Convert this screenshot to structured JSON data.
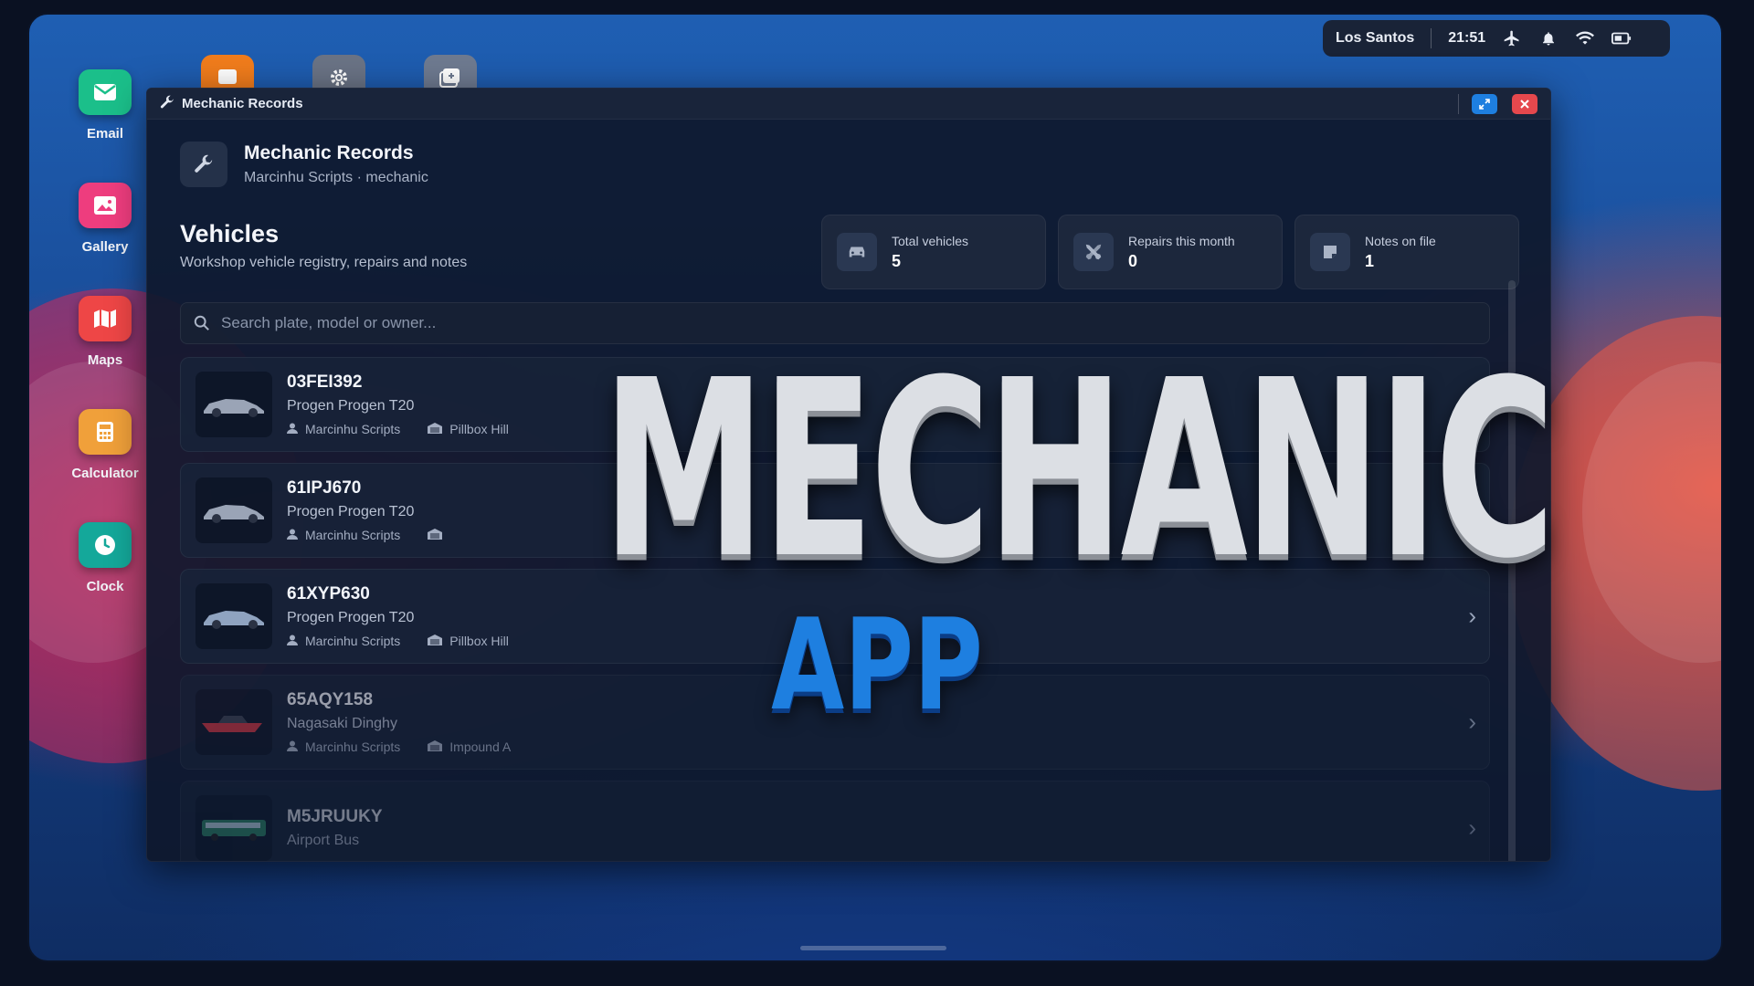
{
  "statusbar": {
    "location": "Los Santos",
    "time": "21:51"
  },
  "dock": [
    {
      "label": "Email",
      "icon": "mail-icon",
      "color": "#1bbf8a"
    },
    {
      "label": "Gallery",
      "icon": "image-icon",
      "color": "#ee3d7e"
    },
    {
      "label": "Maps",
      "icon": "map-icon",
      "color": "#ee4646"
    },
    {
      "label": "Calculator",
      "icon": "calculator-icon",
      "color": "#f0a03a"
    },
    {
      "label": "Clock",
      "icon": "clock-icon",
      "color": "#14a89a"
    }
  ],
  "window": {
    "title": "Mechanic Records",
    "app_title": "Mechanic Records",
    "app_subtitle": "Marcinhu Scripts · mechanic",
    "section_title": "Vehicles",
    "section_subtitle": "Workshop vehicle registry, repairs and notes",
    "stats": [
      {
        "label": "Total vehicles",
        "value": "5",
        "icon": "car-icon"
      },
      {
        "label": "Repairs this month",
        "value": "0",
        "icon": "tools-icon"
      },
      {
        "label": "Notes on file",
        "value": "1",
        "icon": "note-icon"
      }
    ],
    "search_placeholder": "Search plate, model or owner...",
    "vehicles": [
      {
        "plate": "03FEI392",
        "model": "Progen Progen T20",
        "owner": "Marcinhu Scripts",
        "location": "Pillbox Hill"
      },
      {
        "plate": "61IPJ670",
        "model": "Progen Progen T20",
        "owner": "Marcinhu Scripts",
        "location": ""
      },
      {
        "plate": "61XYP630",
        "model": "Progen Progen T20",
        "owner": "Marcinhu Scripts",
        "location": "Pillbox Hill"
      },
      {
        "plate": "65AQY158",
        "model": "Nagasaki Dinghy",
        "owner": "Marcinhu Scripts",
        "location": "Impound A"
      },
      {
        "plate": "M5JRUUKY",
        "model": "Airport Bus",
        "owner": "",
        "location": ""
      }
    ]
  },
  "overlay": {
    "title": "MECHANIC",
    "subtitle": "APP"
  },
  "colors": {
    "accent_blue": "#1e7fe0",
    "close_red": "#e5484d"
  }
}
